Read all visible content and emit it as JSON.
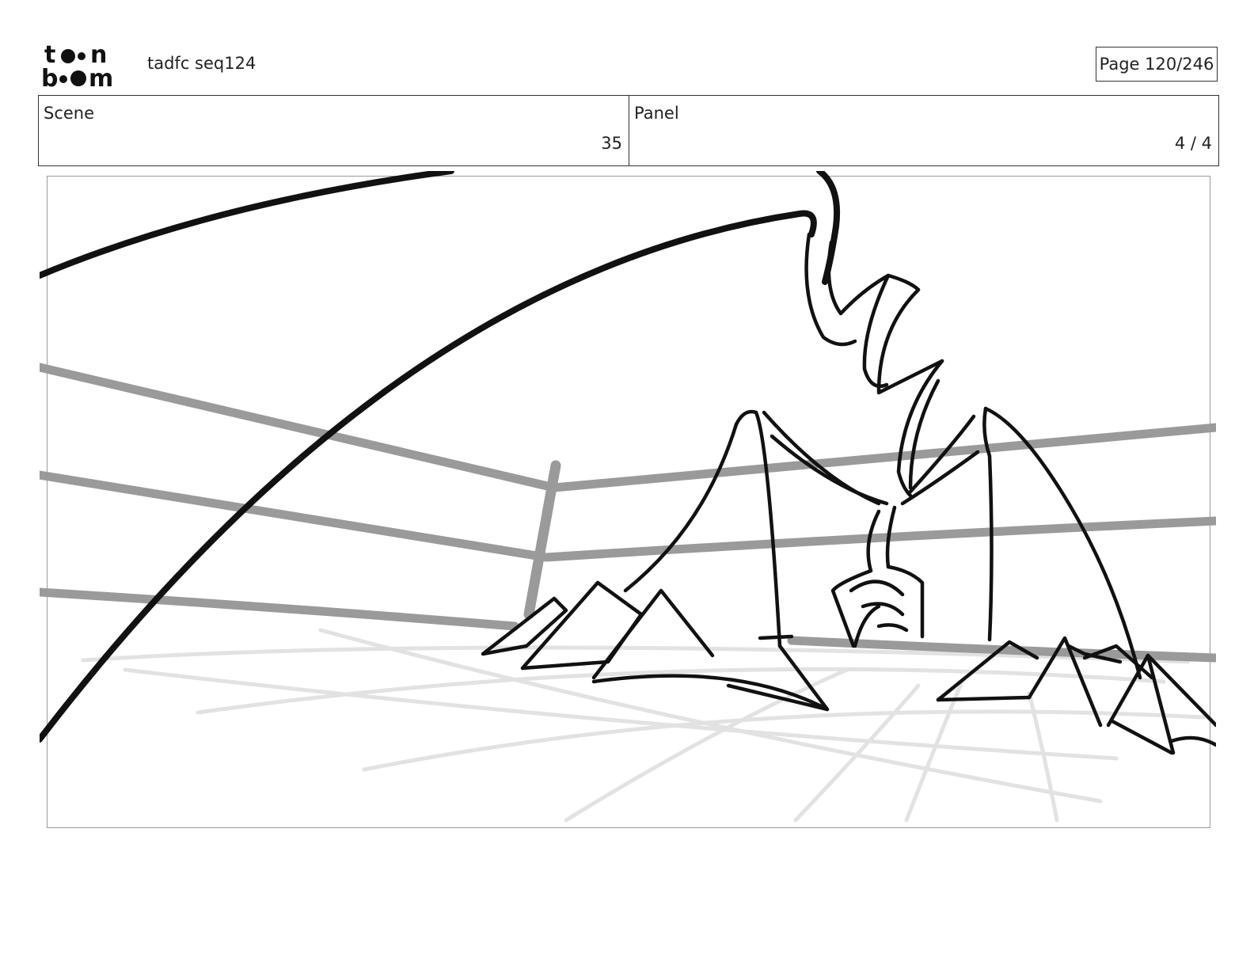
{
  "header": {
    "logo_text": "toon boom",
    "document_title": "tadfc seq124",
    "page_label": "Page 120/246"
  },
  "info": {
    "scene_label": "Scene",
    "scene_value": "35",
    "panel_label": "Panel",
    "panel_value": "4 / 4"
  },
  "colors": {
    "ink": "#111111",
    "rope": "#9a9a9a",
    "mat_lines": "#e2e2e2",
    "frame_border": "#9a9a9a"
  }
}
